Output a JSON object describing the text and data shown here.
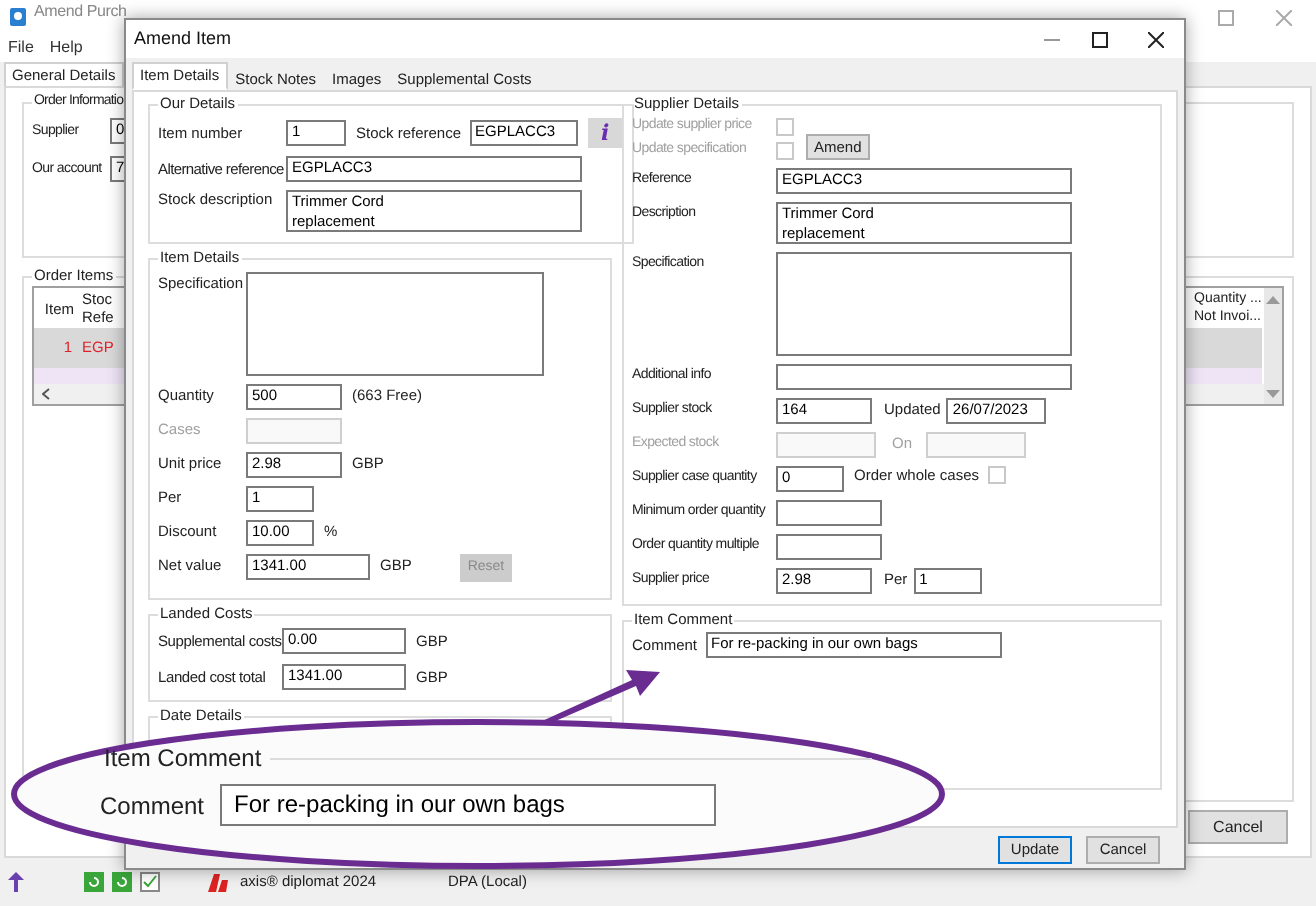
{
  "main_window": {
    "title": "Amend Purch",
    "menu": [
      "File",
      "Help"
    ],
    "tabs": [
      {
        "label": "General Details",
        "selected": true
      }
    ],
    "order_info": {
      "title": "Order Informatio",
      "fields": [
        {
          "label": "Supplier",
          "value": "0"
        },
        {
          "label": "Our account",
          "value": "7"
        }
      ]
    },
    "order_items": {
      "title": "Order Items",
      "columns": [
        [
          "Item"
        ],
        [
          "Stoc",
          "Refe"
        ]
      ],
      "right_column": [
        "Quantity ...",
        "Not Invoi..."
      ],
      "rows": [
        {
          "item": "1",
          "reference": "EGP",
          "selected": true
        }
      ]
    },
    "buttons": [
      "Cancel"
    ]
  },
  "status_bar": {
    "items": [
      "axis® diplomat 2024",
      "DPA (Local)"
    ]
  },
  "dialog": {
    "title": "Amend Item",
    "tabs": [
      {
        "label": "Item Details",
        "selected": true
      },
      {
        "label": "Stock Notes",
        "selected": false
      },
      {
        "label": "Images",
        "selected": false
      },
      {
        "label": "Supplemental Costs",
        "selected": false
      }
    ],
    "our_details": {
      "title": "Our Details",
      "item_number": {
        "label": "Item number",
        "value": "1"
      },
      "stock_reference": {
        "label": "Stock reference",
        "value": "EGPLACC3"
      },
      "info_button": "i",
      "alternative_reference": {
        "label": "Alternative reference",
        "value": "EGPLACC3"
      },
      "stock_description": {
        "label": "Stock description",
        "value": "Trimmer Cord\nreplacement"
      }
    },
    "item_details": {
      "title": "Item Details",
      "rows": [
        {
          "kind": "area",
          "label": "Specification",
          "disabled": false
        },
        {
          "kind": "medium",
          "label": "Quantity",
          "value": "500",
          "note": "(663 Free)",
          "disabled": false
        },
        {
          "kind": "medium",
          "label": "Cases",
          "disabled": true
        },
        {
          "kind": "medium",
          "label": "Unit price",
          "value": "2.98",
          "note": "GBP",
          "disabled": false
        },
        {
          "kind": "short",
          "label": "Per",
          "value": "1",
          "disabled": false
        },
        {
          "kind": "short",
          "label": "Discount",
          "value": "10.00",
          "note": "%",
          "disabled": false
        },
        {
          "kind": "long",
          "label": "Net value",
          "value": "1341.00",
          "note": "GBP",
          "disabled": false,
          "button": {
            "label": "Reset",
            "disabled": true
          }
        }
      ]
    },
    "landed_costs": {
      "title": "Landed Costs",
      "rows": [
        {
          "label": "Supplemental costs",
          "value": "0.00",
          "note": "GBP"
        },
        {
          "label": "Landed cost total",
          "value": "1341.00",
          "note": "GBP"
        }
      ]
    },
    "date_details": {
      "title": "Date Details"
    },
    "supplier_details": {
      "title": "Supplier Details",
      "checks": [
        {
          "label": "Update supplier price",
          "checked": false,
          "disabled": true
        },
        {
          "label": "Update specification",
          "checked": false,
          "disabled": true
        }
      ],
      "amend_button": "Amend",
      "rows": [
        {
          "kind": "long",
          "label": "Reference",
          "value": "EGPLACC3",
          "disabled": false
        },
        {
          "kind": "desc",
          "label": "Description",
          "value": "Trimmer Cord\nreplacement",
          "disabled": false
        },
        {
          "kind": "area",
          "label": "Specification",
          "disabled": false
        },
        {
          "kind": "long",
          "label": "Additional info",
          "disabled": false
        },
        {
          "kind": "pair",
          "label": "Supplier stock",
          "value": "164",
          "label2": "Updated",
          "value2": "26/07/2023",
          "disabled": false
        },
        {
          "kind": "pair",
          "label": "Expected stock",
          "label2": "On",
          "disabled": true
        },
        {
          "kind": "check",
          "label": "Supplier case quantity",
          "value": "0",
          "label2": "Order whole cases",
          "checked": false,
          "disabled": false
        },
        {
          "kind": "medium",
          "label": "Minimum order quantity",
          "disabled": false
        },
        {
          "kind": "medium",
          "label": "Order quantity multiple",
          "disabled": false
        },
        {
          "kind": "pair",
          "label": "Supplier price",
          "value": "2.98",
          "label2": "Per",
          "value2": "1",
          "disabled": false
        }
      ]
    },
    "item_comment": {
      "title": "Item Comment",
      "label": "Comment",
      "value": "For re-packing in our own bags"
    },
    "buttons": [
      {
        "label": "Update",
        "default": true
      },
      {
        "label": "Cancel",
        "default": false
      }
    ]
  },
  "callout": {
    "title": "Item Comment",
    "label": "Comment",
    "value": "For re-packing in our own bags"
  }
}
